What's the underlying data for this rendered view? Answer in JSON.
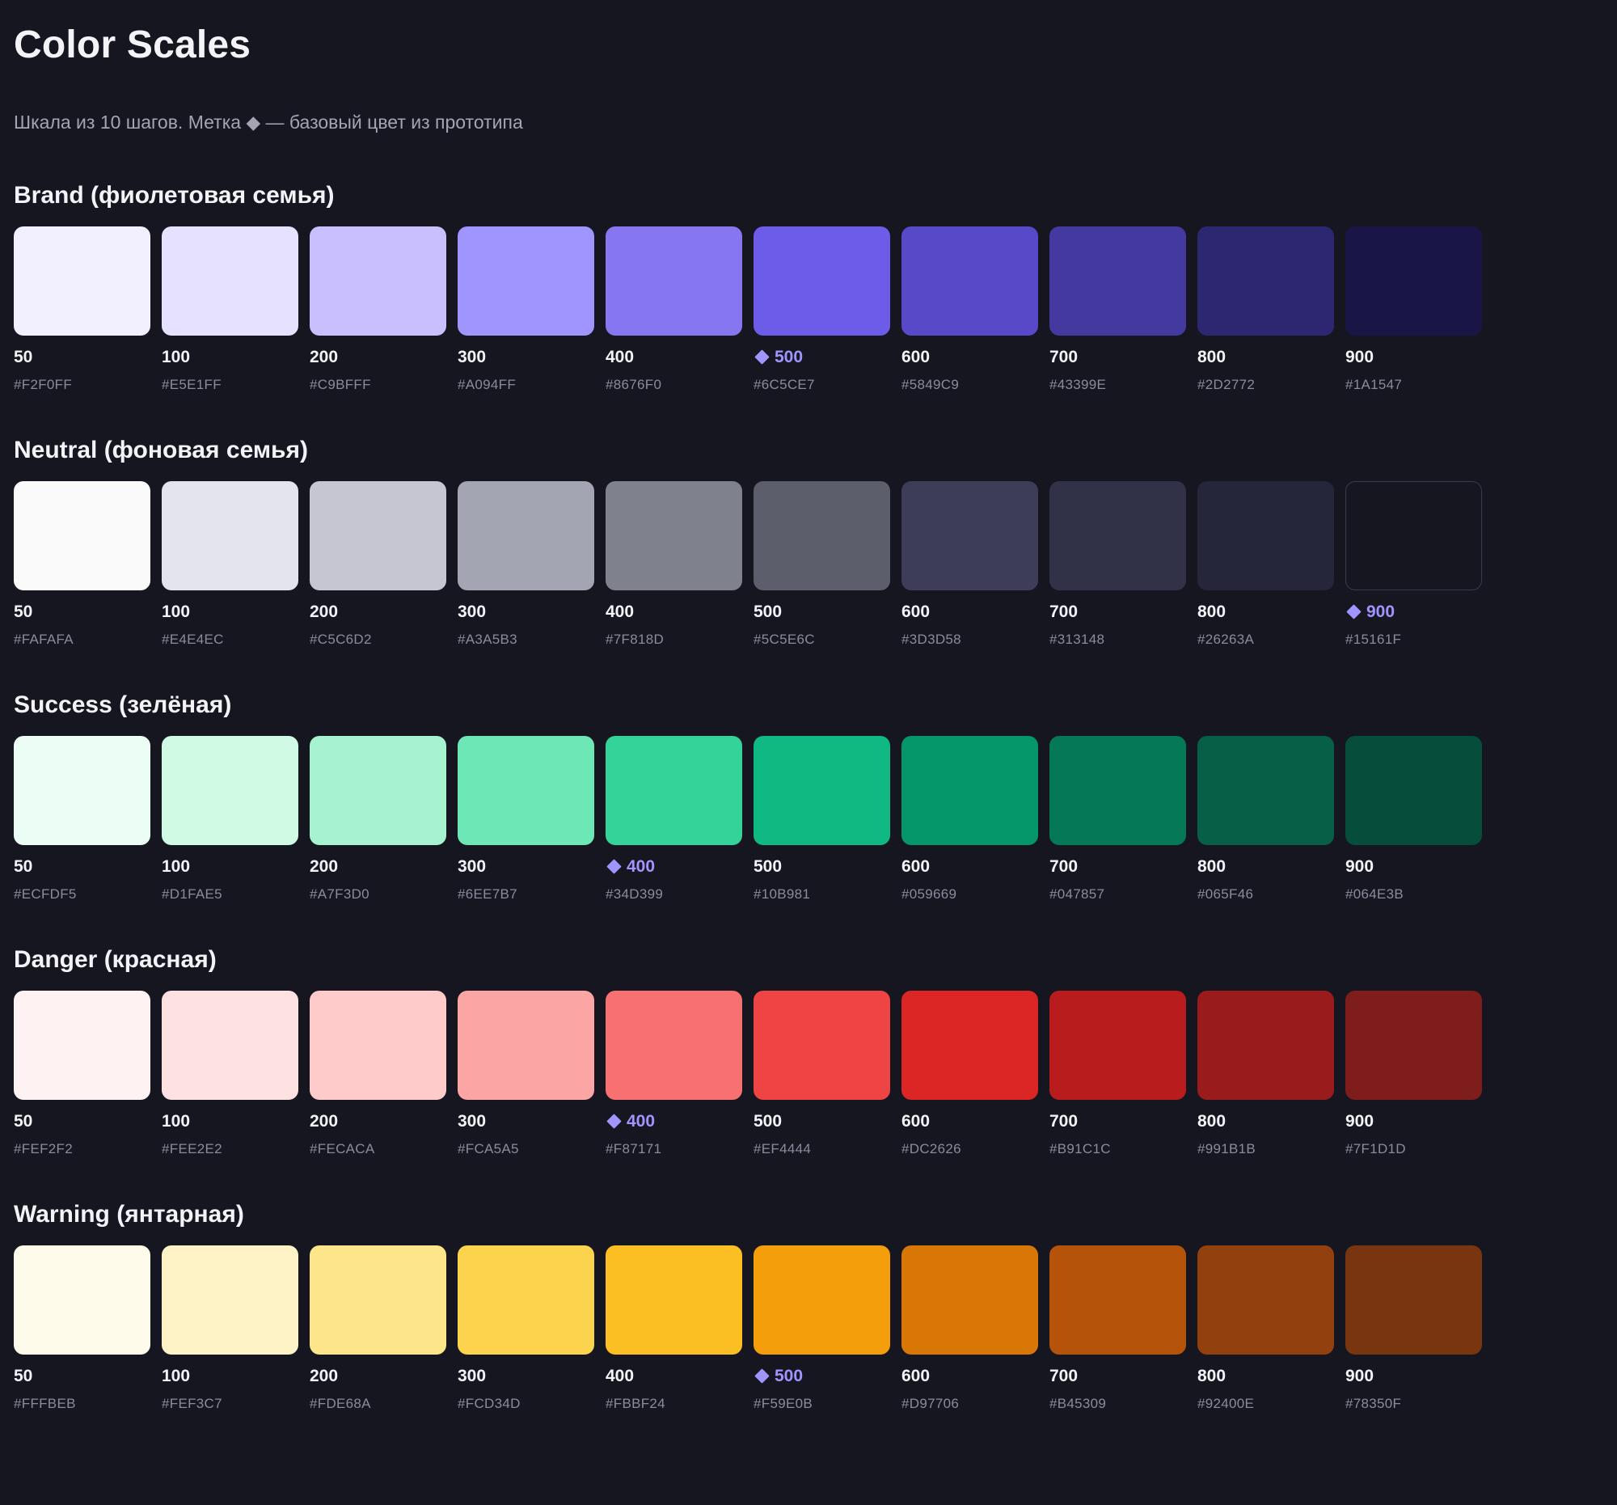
{
  "page": {
    "title": "Color Scales",
    "subtitle": "Шкала из 10 шагов. Метка ◆ — базовый цвет из прототипа"
  },
  "scales": [
    {
      "name": "Brand (фиолетовая семья)",
      "swatches": [
        {
          "step": "50",
          "hex": "#F2F0FF",
          "base": false
        },
        {
          "step": "100",
          "hex": "#E5E1FF",
          "base": false
        },
        {
          "step": "200",
          "hex": "#C9BFFF",
          "base": false
        },
        {
          "step": "300",
          "hex": "#A094FF",
          "base": false
        },
        {
          "step": "400",
          "hex": "#8676F0",
          "base": false
        },
        {
          "step": "500",
          "hex": "#6C5CE7",
          "base": true
        },
        {
          "step": "600",
          "hex": "#5849C9",
          "base": false
        },
        {
          "step": "700",
          "hex": "#43399E",
          "base": false
        },
        {
          "step": "800",
          "hex": "#2D2772",
          "base": false
        },
        {
          "step": "900",
          "hex": "#1A1547",
          "base": false
        }
      ]
    },
    {
      "name": "Neutral (фоновая семья)",
      "swatches": [
        {
          "step": "50",
          "hex": "#FAFAFA",
          "base": false
        },
        {
          "step": "100",
          "hex": "#E4E4EC",
          "base": false
        },
        {
          "step": "200",
          "hex": "#C5C6D2",
          "base": false
        },
        {
          "step": "300",
          "hex": "#A3A5B3",
          "base": false
        },
        {
          "step": "400",
          "hex": "#7F818D",
          "base": false
        },
        {
          "step": "500",
          "hex": "#5C5E6C",
          "base": false
        },
        {
          "step": "600",
          "hex": "#3D3D58",
          "base": false
        },
        {
          "step": "700",
          "hex": "#313148",
          "base": false
        },
        {
          "step": "800",
          "hex": "#26263A",
          "base": false
        },
        {
          "step": "900",
          "hex": "#15161F",
          "base": true
        }
      ]
    },
    {
      "name": "Success (зелёная)",
      "swatches": [
        {
          "step": "50",
          "hex": "#ECFDF5",
          "base": false
        },
        {
          "step": "100",
          "hex": "#D1FAE5",
          "base": false
        },
        {
          "step": "200",
          "hex": "#A7F3D0",
          "base": false
        },
        {
          "step": "300",
          "hex": "#6EE7B7",
          "base": false
        },
        {
          "step": "400",
          "hex": "#34D399",
          "base": true
        },
        {
          "step": "500",
          "hex": "#10B981",
          "base": false
        },
        {
          "step": "600",
          "hex": "#059669",
          "base": false
        },
        {
          "step": "700",
          "hex": "#047857",
          "base": false
        },
        {
          "step": "800",
          "hex": "#065F46",
          "base": false
        },
        {
          "step": "900",
          "hex": "#064E3B",
          "base": false
        }
      ]
    },
    {
      "name": "Danger (красная)",
      "swatches": [
        {
          "step": "50",
          "hex": "#FEF2F2",
          "base": false
        },
        {
          "step": "100",
          "hex": "#FEE2E2",
          "base": false
        },
        {
          "step": "200",
          "hex": "#FECACA",
          "base": false
        },
        {
          "step": "300",
          "hex": "#FCA5A5",
          "base": false
        },
        {
          "step": "400",
          "hex": "#F87171",
          "base": true
        },
        {
          "step": "500",
          "hex": "#EF4444",
          "base": false
        },
        {
          "step": "600",
          "hex": "#DC2626",
          "base": false
        },
        {
          "step": "700",
          "hex": "#B91C1C",
          "base": false
        },
        {
          "step": "800",
          "hex": "#991B1B",
          "base": false
        },
        {
          "step": "900",
          "hex": "#7F1D1D",
          "base": false
        }
      ]
    },
    {
      "name": "Warning (янтарная)",
      "swatches": [
        {
          "step": "50",
          "hex": "#FFFBEB",
          "base": false
        },
        {
          "step": "100",
          "hex": "#FEF3C7",
          "base": false
        },
        {
          "step": "200",
          "hex": "#FDE68A",
          "base": false
        },
        {
          "step": "300",
          "hex": "#FCD34D",
          "base": false
        },
        {
          "step": "400",
          "hex": "#FBBF24",
          "base": false
        },
        {
          "step": "500",
          "hex": "#F59E0B",
          "base": true
        },
        {
          "step": "600",
          "hex": "#D97706",
          "base": false
        },
        {
          "step": "700",
          "hex": "#B45309",
          "base": false
        },
        {
          "step": "800",
          "hex": "#92400E",
          "base": false
        },
        {
          "step": "900",
          "hex": "#78350F",
          "base": false
        }
      ]
    }
  ]
}
